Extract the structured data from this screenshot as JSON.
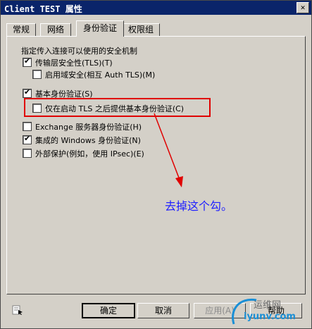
{
  "window": {
    "title": "Client TEST 属性",
    "close_label": "✕"
  },
  "tabs": [
    {
      "label": "常规",
      "active": false
    },
    {
      "label": "网络",
      "active": false
    },
    {
      "label": "身份验证",
      "active": true
    },
    {
      "label": "权限组",
      "active": false
    }
  ],
  "panel": {
    "intro": "指定传入连接可以使用的安全机制",
    "options": {
      "tls": {
        "label": "传输层安全性(TLS)(T)",
        "checked": true
      },
      "domain_tls": {
        "label": "启用域安全(相互 Auth TLS)(M)",
        "checked": false
      },
      "basic_auth": {
        "label": "基本身份验证(S)",
        "checked": true
      },
      "basic_after_tls": {
        "label": "仅在启动 TLS 之后提供基本身份验证(C)",
        "checked": false
      },
      "exchange_server": {
        "label": "Exchange 服务器身份验证(H)",
        "checked": false
      },
      "windows_integrated": {
        "label": "集成的 Windows 身份验证(N)",
        "checked": true
      },
      "external": {
        "label": "外部保护(例如，使用 IPsec)(E)",
        "checked": false
      }
    }
  },
  "annotation": {
    "text": "去掉这个勾。",
    "color": "#2020ff"
  },
  "buttons": {
    "ok": "确定",
    "cancel": "取消",
    "apply": "应用(A)",
    "help": "帮助"
  },
  "watermark": {
    "line1": "运维网",
    "line2": "iyunv.com"
  },
  "colors": {
    "titlebar": "#0a246a",
    "highlight": "#e00000",
    "arrow": "#e00000"
  }
}
